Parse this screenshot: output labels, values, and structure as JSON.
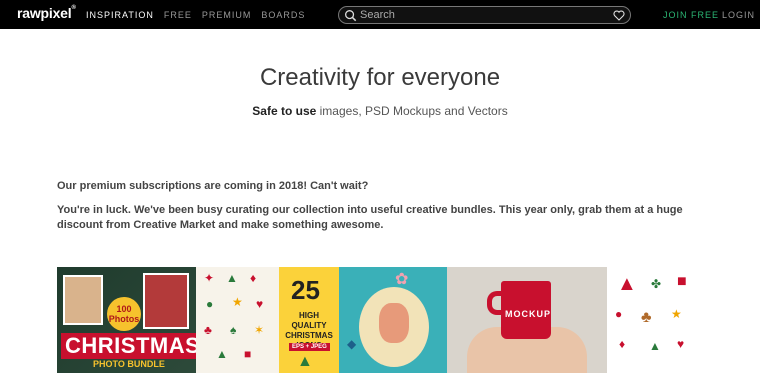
{
  "header": {
    "logo": "rawpixel",
    "logo_mark": "®",
    "nav": [
      "INSPIRATION",
      "FREE",
      "PREMIUM",
      "BOARDS"
    ],
    "search_placeholder": "Search",
    "join_label": "JOIN FREE",
    "login_label": "LOGIN"
  },
  "hero": {
    "title": "Creativity for everyone",
    "subtitle_bold": "Safe to use",
    "subtitle_rest": " images, PSD Mockups and Vectors"
  },
  "content": {
    "announcement": "Our premium subscriptions are coming in 2018! Can't wait?",
    "body": "You're in luck. We've been busy curating our collection into useful creative bundles. This year only, grab them at a huge discount from Creative Market and make something awesome."
  },
  "banner": {
    "christmas_badge": "100 Photos",
    "christmas_title": "CHRISTMAS",
    "christmas_sub": "PHOTO BUNDLE",
    "icons_number": "25",
    "icons_title": "HIGH QUALITY CHRISTMAS ICONS",
    "icons_formats": "EPS + JPEG",
    "mockup_label": "MOCKUP"
  },
  "colors": {
    "topbar_bg": "#000000",
    "join_accent": "#2bb673",
    "nav_active": "#ffffff",
    "nav_inactive": "#999999"
  }
}
